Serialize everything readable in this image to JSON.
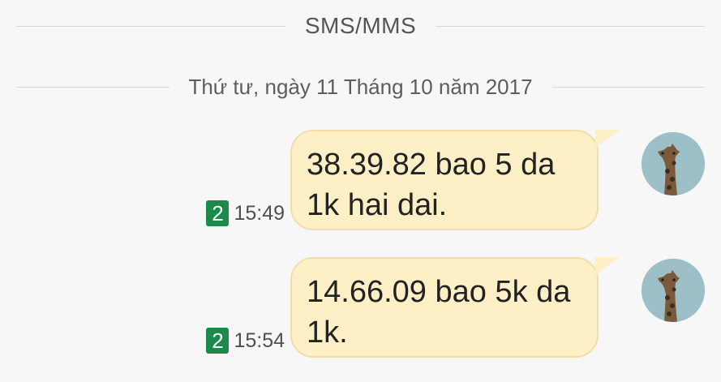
{
  "header": {
    "channel_label": "SMS/MMS",
    "date_label": "Thứ tư, ngày 11 Tháng 10 năm 2017"
  },
  "messages": [
    {
      "text": "38.39.82 bao 5 da 1k hai dai.",
      "time": "15:49",
      "sim": "2",
      "avatar_icon": "giraffe-avatar-icon"
    },
    {
      "text": "14.66.09 bao 5k da 1k.",
      "time": "15:54",
      "sim": "2",
      "avatar_icon": "giraffe-avatar-icon"
    }
  ],
  "colors": {
    "bubble": "#fdefc6",
    "sim_badge": "#1c8a4a",
    "background": "#f7f7f7"
  }
}
